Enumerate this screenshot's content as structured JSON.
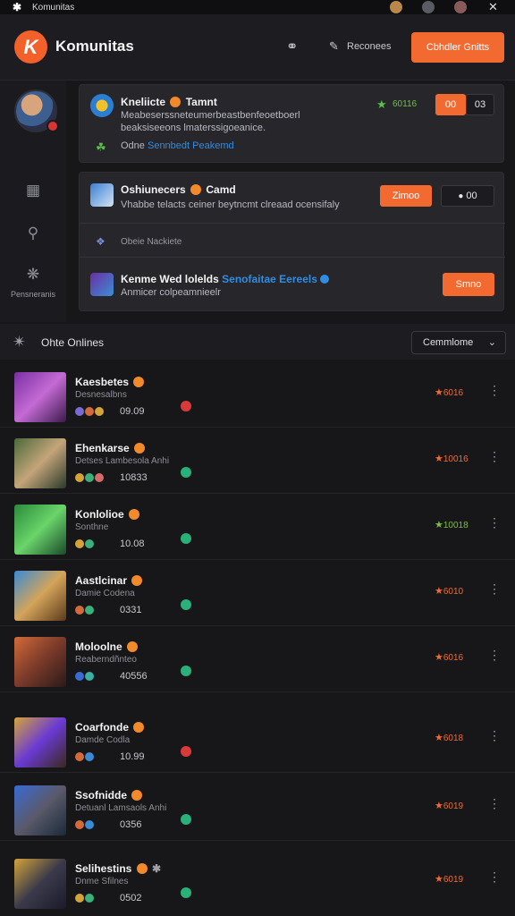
{
  "app": {
    "title": "Komunitas"
  },
  "header": {
    "brand_title": "Komunitas",
    "link_label": "Reconees",
    "cta_label": "Cbhdler Gnitts"
  },
  "rail": {
    "label": "Pensneranis"
  },
  "notifications": [
    {
      "name": "Kneliicte",
      "tag": "Tamnt",
      "line1": "Meabeserssneteumerbeastbenfeoetboerl",
      "line2": "beaksiseeons lmaterssigoeanice.",
      "meta_prefix": "Odne",
      "meta_link": "Sennbedt Peakemd",
      "score": "60116",
      "btn1": "00",
      "btn2": "03"
    },
    {
      "name": "Oshiunecers",
      "tag": "Camd",
      "line1": "Vhabbe telacts ceiner beytncmt clreaad ocensifaly",
      "btn1": "Zimoo",
      "btn2": "00"
    },
    {
      "name": "Obeie Nackiete",
      "line1": ""
    },
    {
      "name": "Kenme Wed lolelds",
      "link": "Senofaitae Eereels",
      "line1": "Anmicer colpeamnieelr",
      "btn1": "Smno"
    }
  ],
  "online": {
    "title": "Ohte Onlines",
    "dropdown": "Cemmlome"
  },
  "users": [
    {
      "name": "Kaesbetes",
      "sub": "Desnesalbns",
      "count": "09.09",
      "score": "6016",
      "status": "#d83a3a",
      "score_color": "#f26a30"
    },
    {
      "name": "Ehenkarse",
      "sub": "Detses Lambesola Anhi",
      "count": "10833",
      "score": "10016",
      "status": "#2ab07a",
      "score_color": "#f26a30"
    },
    {
      "name": "Konlolioe",
      "sub": "Sonthne",
      "count": "10.08",
      "score": "10018",
      "status": "#2ab07a",
      "score_color": "#7fbf3a"
    },
    {
      "name": "Aastlcinar",
      "sub": "Damie Codena",
      "count": "0331",
      "score": "6010",
      "status": "#2ab07a",
      "score_color": "#f26a30"
    },
    {
      "name": "Moloolne",
      "sub": "Reaberndñnteo",
      "count": "40556",
      "score": "6016",
      "status": "#2ab07a",
      "score_color": "#f26a30"
    },
    {
      "name": "Coarfonde",
      "sub": "Damde Codla",
      "count": "10.99",
      "score": "6018",
      "status": "#d83a3a",
      "score_color": "#f26a30"
    },
    {
      "name": "Ssofnidde",
      "sub": "Detuanl Lamsaols Anhi",
      "count": "0356",
      "score": "6019",
      "status": "#2ab07a",
      "score_color": "#f26a30"
    },
    {
      "name": "Selihestins",
      "sub": "Dnme Sfilnes",
      "count": "0502",
      "score": "6019",
      "status": "#2ab07a",
      "score_color": "#f26a30"
    }
  ]
}
